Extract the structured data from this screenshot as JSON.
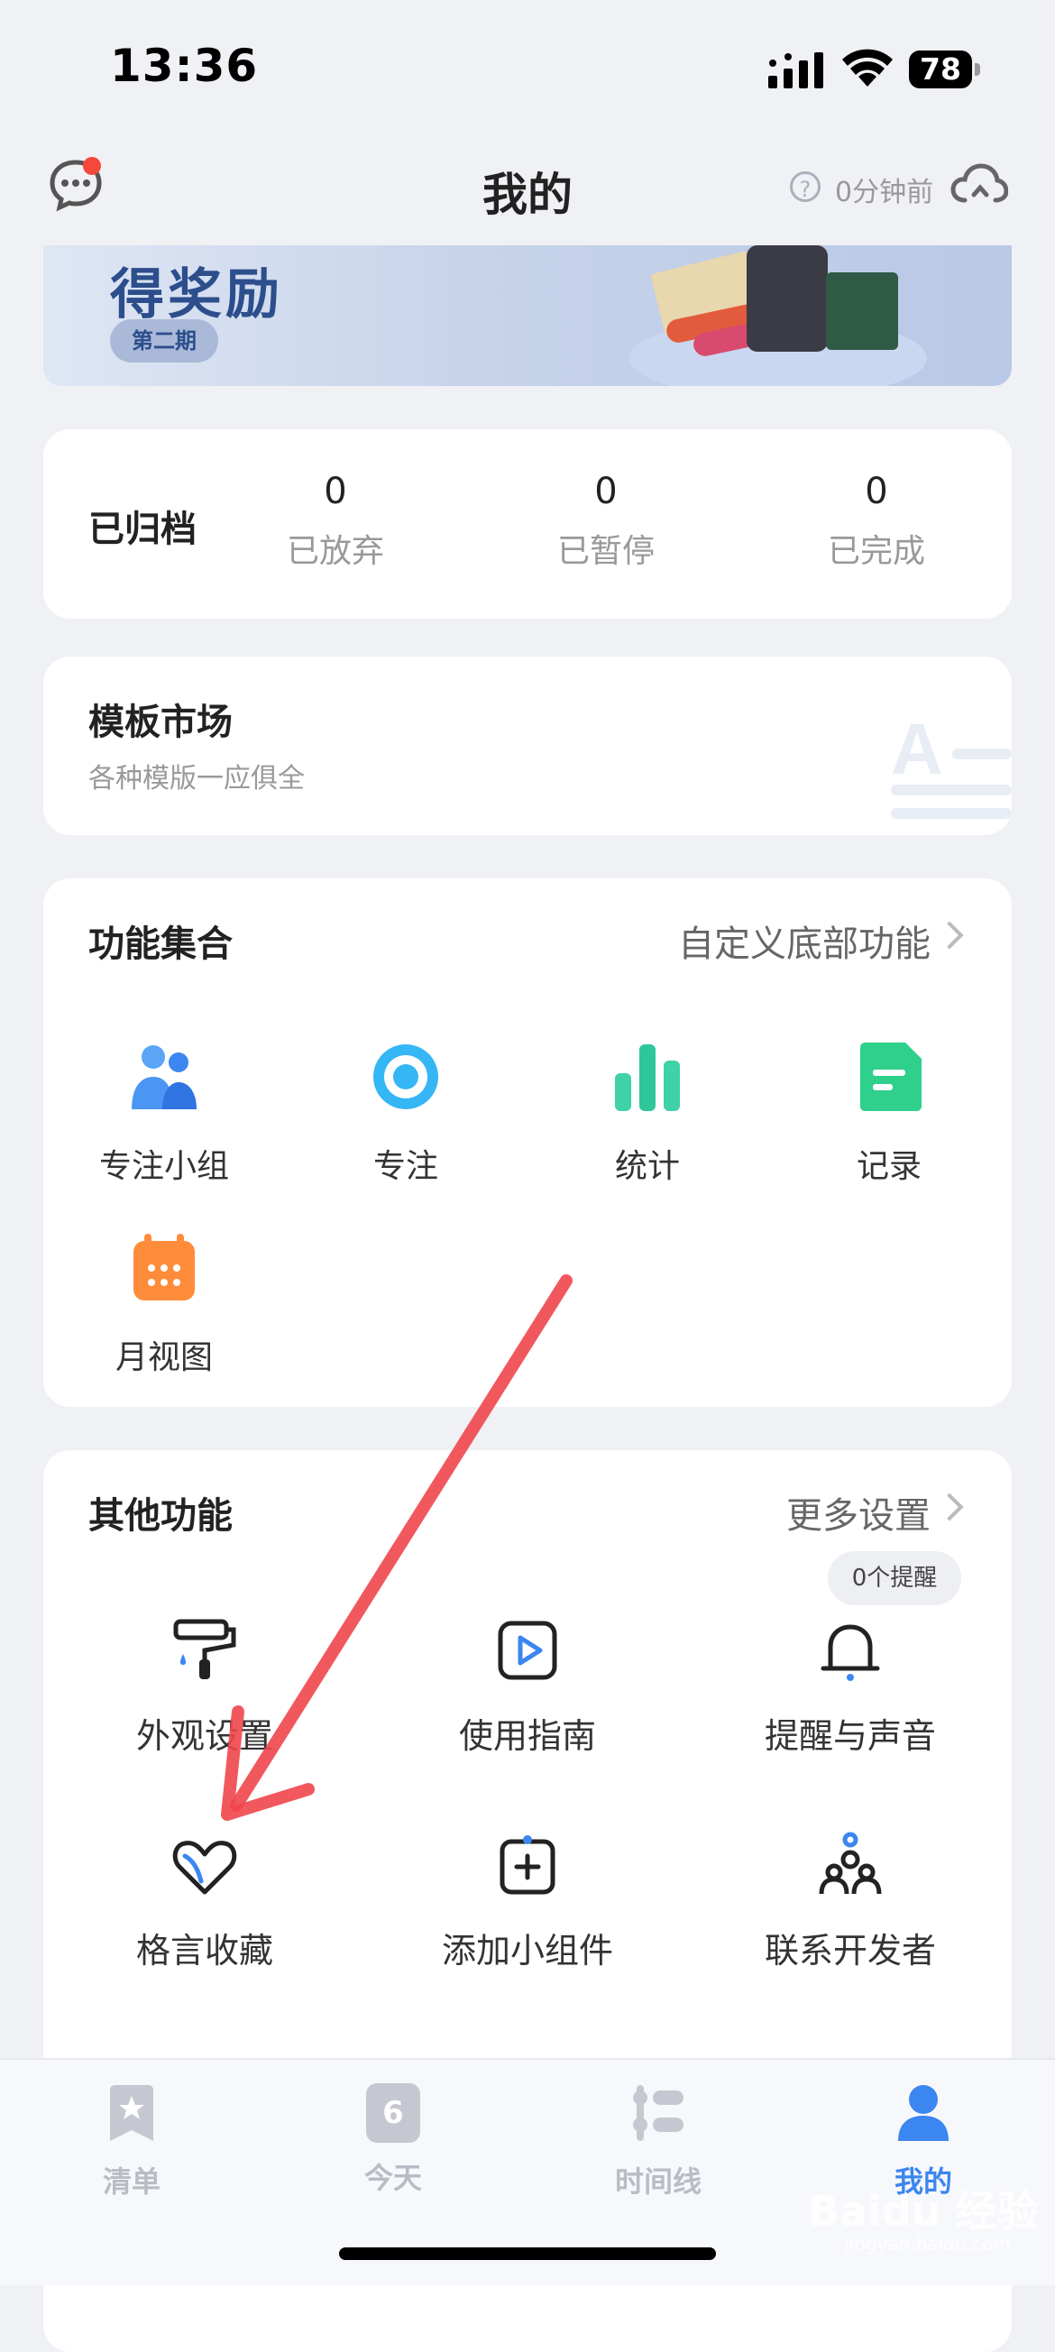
{
  "status_bar": {
    "time": "13:36",
    "battery": "78"
  },
  "header": {
    "title": "我的",
    "sync_text": "0分钟前"
  },
  "banner": {
    "title": "得奖励",
    "badge": "第二期"
  },
  "archive": {
    "label": "已归档",
    "stats": [
      {
        "value": "0",
        "label": "已放弃"
      },
      {
        "value": "0",
        "label": "已暂停"
      },
      {
        "value": "0",
        "label": "已完成"
      }
    ]
  },
  "template_market": {
    "title": "模板市场",
    "subtitle": "各种模版一应俱全"
  },
  "features": {
    "title": "功能集合",
    "link": "自定义底部功能",
    "items": [
      {
        "label": "专注小组",
        "icon": "group-icon"
      },
      {
        "label": "专注",
        "icon": "focus-target-icon"
      },
      {
        "label": "统计",
        "icon": "bar-chart-icon"
      },
      {
        "label": "记录",
        "icon": "note-icon"
      },
      {
        "label": "月视图",
        "icon": "calendar-icon"
      }
    ]
  },
  "other": {
    "title": "其他功能",
    "link": "更多设置",
    "reminder_badge": "0个提醒",
    "items": [
      {
        "label": "外观设置",
        "icon": "paint-roller-icon"
      },
      {
        "label": "使用指南",
        "icon": "play-guide-icon"
      },
      {
        "label": "提醒与声音",
        "icon": "bell-icon"
      },
      {
        "label": "格言收藏",
        "icon": "heart-icon"
      },
      {
        "label": "添加小组件",
        "icon": "add-widget-icon"
      },
      {
        "label": "联系开发者",
        "icon": "contact-icon"
      }
    ]
  },
  "tabbar": {
    "tabs": [
      {
        "label": "清单",
        "icon": "list-star-icon"
      },
      {
        "label": "今天",
        "icon": "today-icon",
        "day": "6"
      },
      {
        "label": "时间线",
        "icon": "timeline-icon"
      },
      {
        "label": "我的",
        "icon": "profile-icon",
        "active": true
      }
    ]
  },
  "watermark": {
    "text": "Baidu 经验",
    "sub": "jingyan.baidu.com"
  },
  "colors": {
    "accent": "#3b86f0",
    "arrow": "#f0464b",
    "badge_dot": "#f5483b"
  }
}
